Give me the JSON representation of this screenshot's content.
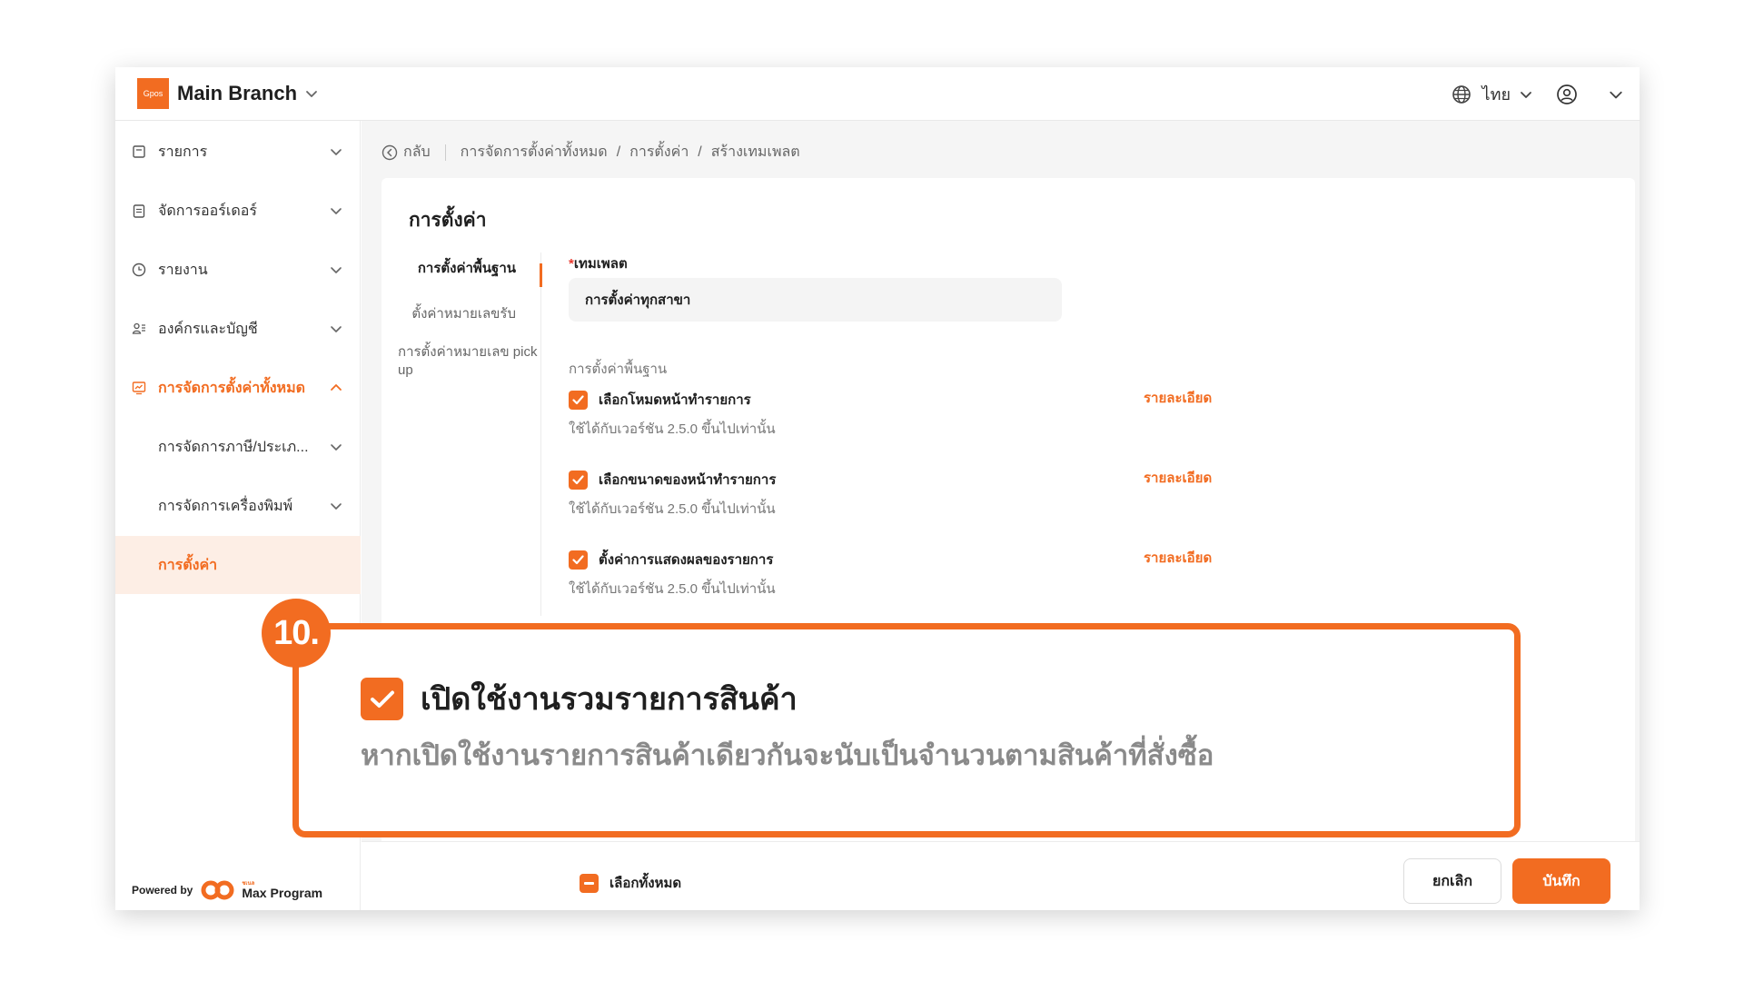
{
  "header": {
    "logo_text": "Gpos",
    "branch": "Main Branch",
    "language": "ไทย"
  },
  "sidebar": {
    "items": [
      {
        "label": "รายการ"
      },
      {
        "label": "จัดการออร์เดอร์"
      },
      {
        "label": "รายงาน"
      },
      {
        "label": "องค์กรและบัญชี"
      },
      {
        "label": "การจัดการตั้งค่าทั้งหมด"
      }
    ],
    "sub_items": [
      {
        "label": "การจัดการภาษี/ประเภ..."
      },
      {
        "label": "การจัดการเครื่องพิมพ์"
      },
      {
        "label": "การตั้งค่า"
      }
    ],
    "powered_by": "Powered by",
    "brand_sub": "ชเนล",
    "brand_name": "Max Program"
  },
  "breadcrumb": {
    "back": "กลับ",
    "items": [
      "การจัดการตั้งค่าทั้งหมด",
      "การตั้งค่า",
      "สร้างเทมเพลต"
    ],
    "separator": "/"
  },
  "card": {
    "title": "การตั้งค่า",
    "tabs": [
      {
        "label": "การตั้งค่าพื้นฐาน"
      },
      {
        "label": "ตั้งค่าหมายเลขรับ"
      },
      {
        "label": "การตั้งค่าหมายเลข pick up"
      }
    ]
  },
  "form": {
    "template_required": "*",
    "template_label": "เทมเพลต",
    "template_value": "การตั้งค่าทุกสาขา",
    "section_title": "การตั้งค่าพื้นฐาน",
    "options": [
      {
        "label": "เลือกโหมดหน้าทำรายการ",
        "desc": "ใช้ได้กับเวอร์ชัน 2.5.0 ขึ้นไปเท่านั้น",
        "detail": "รายละเอียด",
        "checked": true
      },
      {
        "label": "เลือกขนาดของหน้าทำรายการ",
        "desc": "ใช้ได้กับเวอร์ชัน 2.5.0 ขึ้นไปเท่านั้น",
        "detail": "รายละเอียด",
        "checked": true
      },
      {
        "label": "ตั้งค่าการแสดงผลของรายการ",
        "desc": "ใช้ได้กับเวอร์ชัน 2.5.0 ขึ้นไปเท่านั้น",
        "detail": "รายละเอียด",
        "checked": true
      }
    ]
  },
  "footer": {
    "select_all": "เลือกทั้งหมด",
    "cancel": "ยกเลิก",
    "save": "บันทึก"
  },
  "callout": {
    "step": "10.",
    "title": "เปิดใช้งานรวมรายการสินค้า",
    "desc": "หากเปิดใช้งานรายการสินค้าเดียวกันจะนับเป็นจำนวนตามสินค้าที่สั่งซื้อ",
    "checked": true
  },
  "colors": {
    "accent": "#f26c21",
    "active_bg": "#fdeee5"
  }
}
